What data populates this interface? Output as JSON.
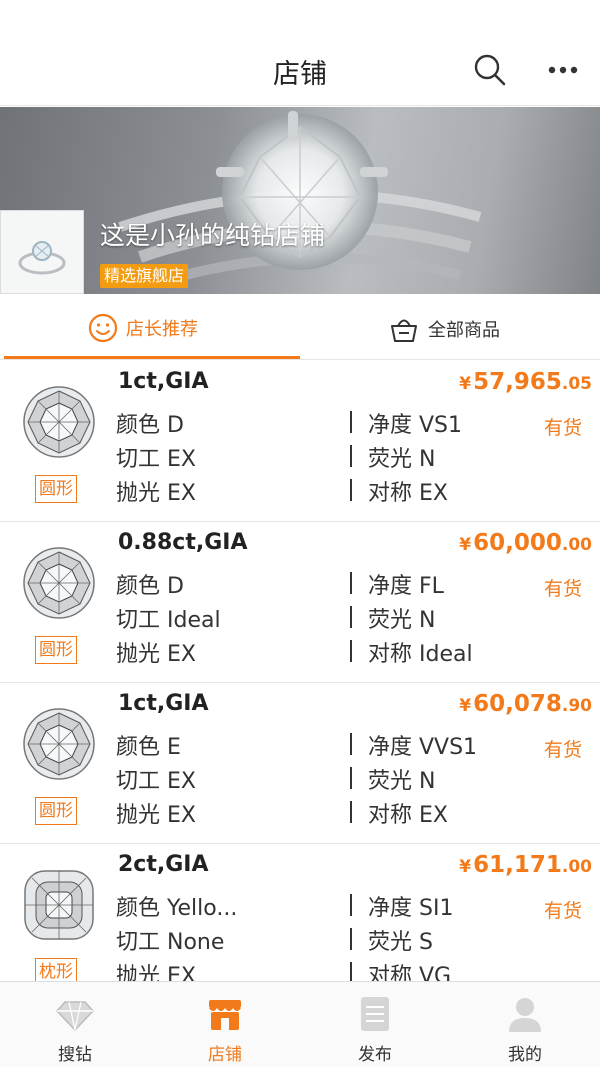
{
  "header": {
    "title": "店铺"
  },
  "banner": {
    "shop_name": "这是小孙的纯钻店铺",
    "badge": "精选旗舰店"
  },
  "tabs": [
    {
      "label": "店长推荐",
      "active": true
    },
    {
      "label": "全部商品",
      "active": false
    }
  ],
  "products": [
    {
      "title": "1ct,GIA",
      "price_symbol": "¥",
      "price_int": "57,965",
      "price_dec": ".05",
      "color": "颜色 D",
      "clarity": "净度 VS1",
      "cut": "切工 EX",
      "fluorescence": "荧光 N",
      "polish": "抛光 EX",
      "symmetry": "对称 EX",
      "stock": "有货",
      "shape": "圆形"
    },
    {
      "title": "0.88ct,GIA",
      "price_symbol": "¥",
      "price_int": "60,000",
      "price_dec": ".00",
      "color": "颜色 D",
      "clarity": "净度 FL",
      "cut": "切工 Ideal",
      "fluorescence": "荧光 N",
      "polish": "抛光 EX",
      "symmetry": "对称 Ideal",
      "stock": "有货",
      "shape": "圆形"
    },
    {
      "title": "1ct,GIA",
      "price_symbol": "¥",
      "price_int": "60,078",
      "price_dec": ".90",
      "color": "颜色 E",
      "clarity": "净度 VVS1",
      "cut": "切工 EX",
      "fluorescence": "荧光 N",
      "polish": "抛光 EX",
      "symmetry": "对称 EX",
      "stock": "有货",
      "shape": "圆形"
    },
    {
      "title": "2ct,GIA",
      "price_symbol": "¥",
      "price_int": "61,171",
      "price_dec": ".00",
      "color": "颜色 Yello...",
      "clarity": "净度 SI1",
      "cut": "切工 None",
      "fluorescence": "荧光 S",
      "polish": "抛光 EX",
      "symmetry": "对称 VG",
      "stock": "有货",
      "shape": "枕形"
    }
  ],
  "bottom_nav": [
    {
      "label": "搜钻",
      "icon": "diamond-icon",
      "active": false
    },
    {
      "label": "店铺",
      "icon": "store-icon",
      "active": true
    },
    {
      "label": "发布",
      "icon": "document-icon",
      "active": false
    },
    {
      "label": "我的",
      "icon": "person-icon",
      "active": false
    }
  ],
  "colors": {
    "accent": "#f27a1a",
    "badge": "#f39c12",
    "text": "#333333"
  }
}
